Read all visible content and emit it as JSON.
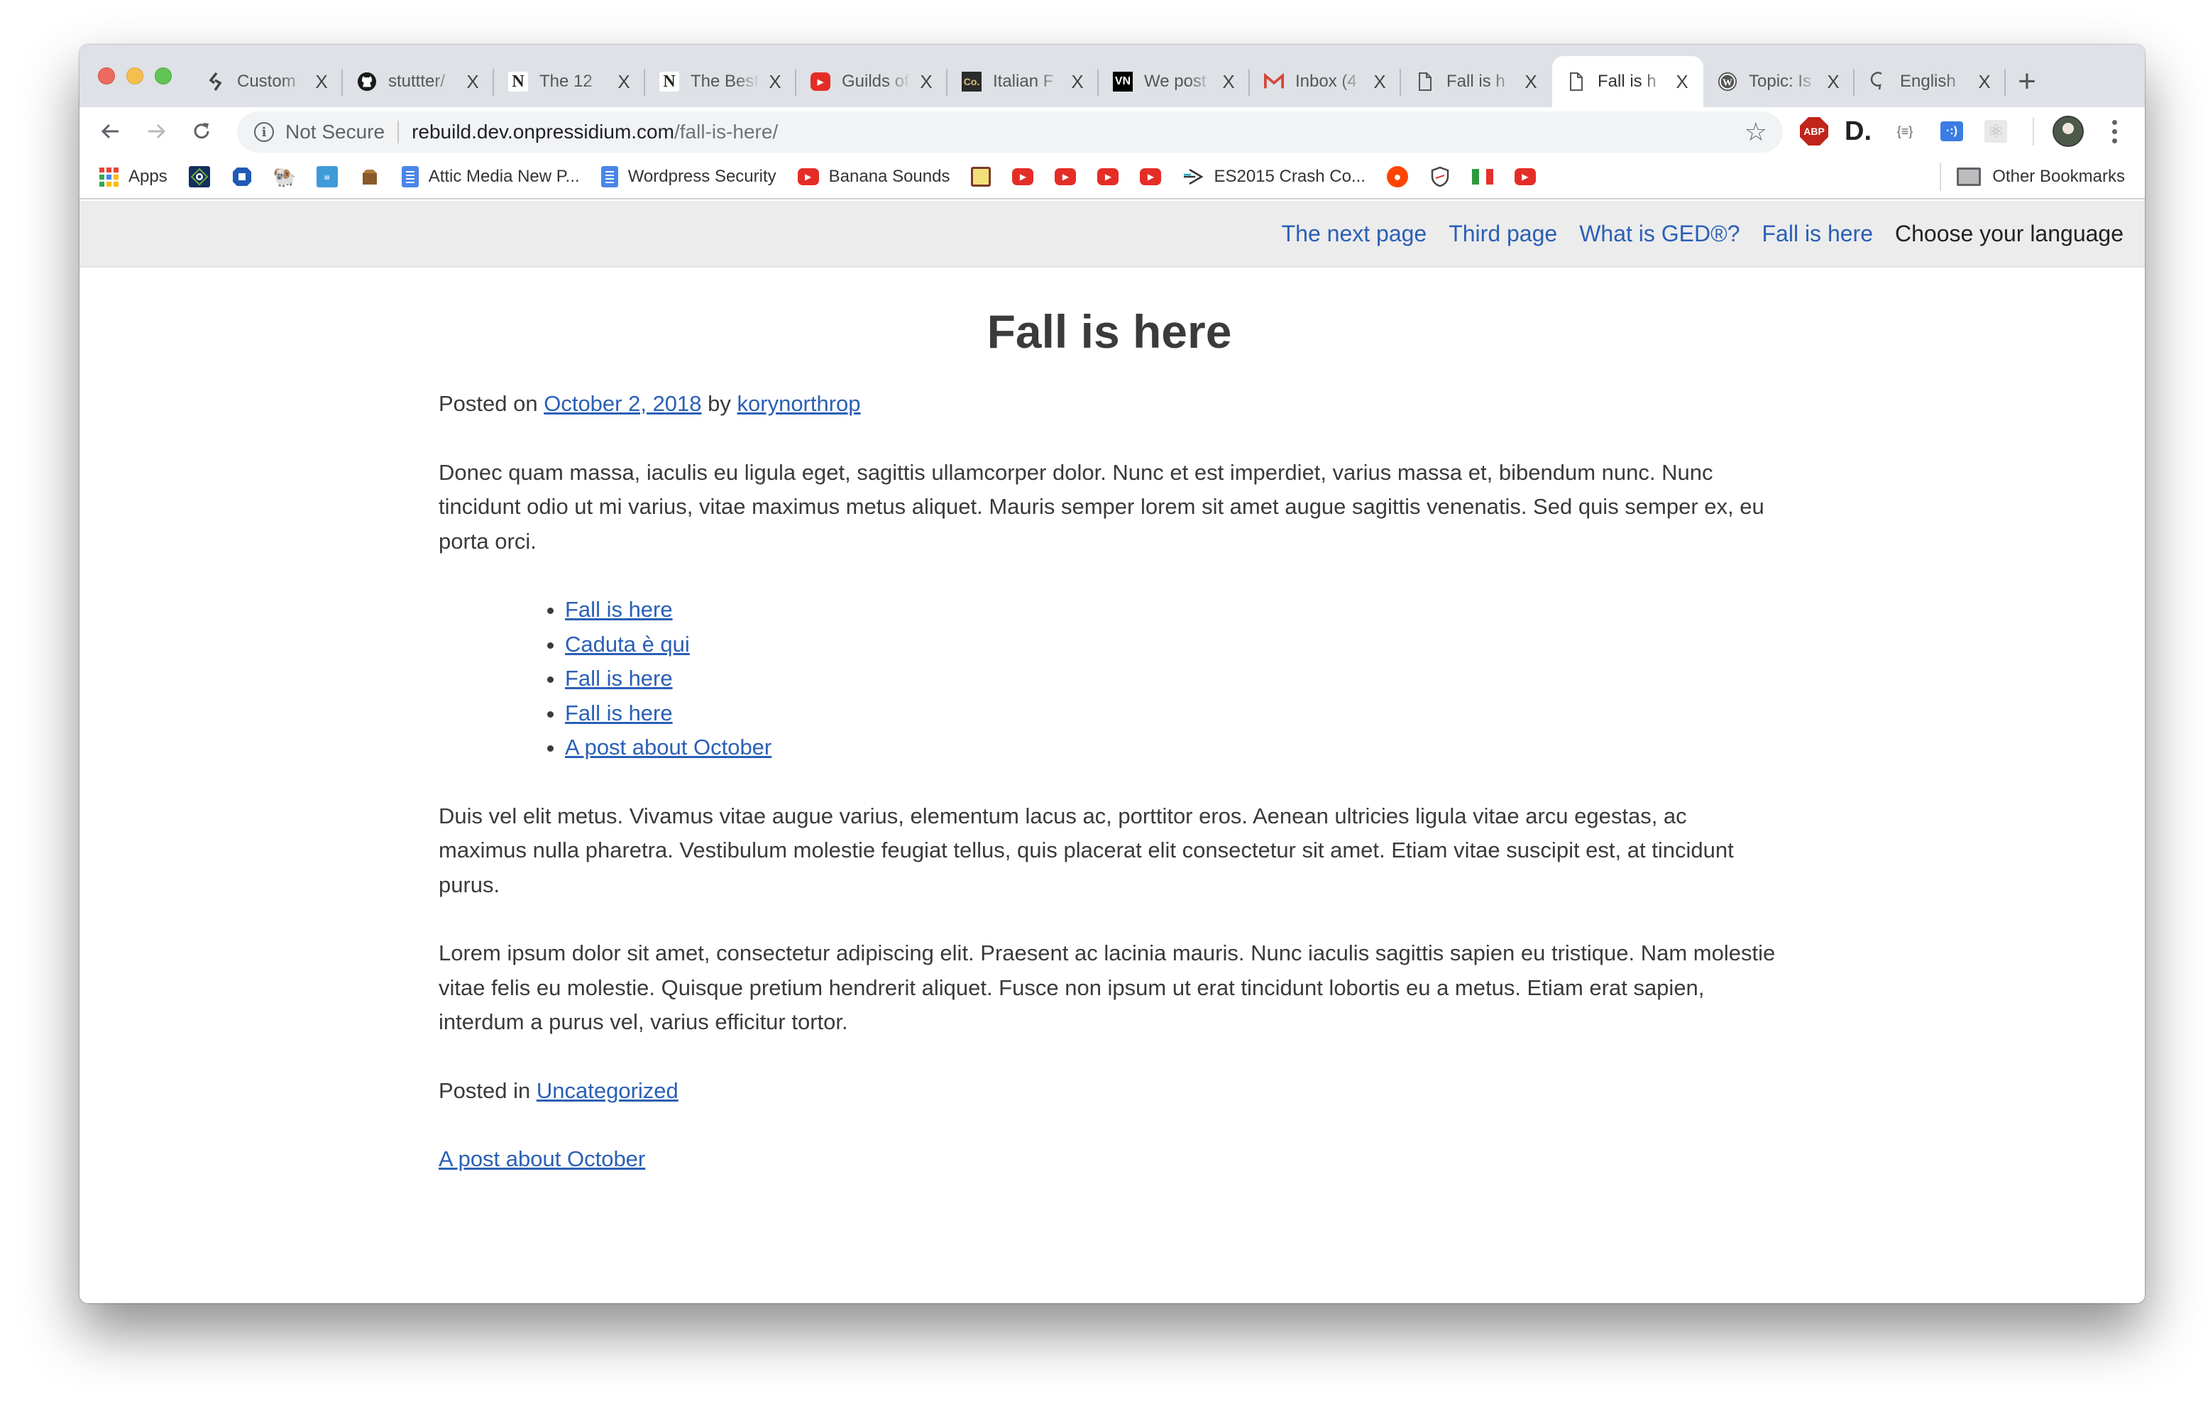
{
  "browser": {
    "tabs": [
      {
        "icon": "codeanywhere-icon",
        "title": "Custom",
        "active": false
      },
      {
        "icon": "github-icon",
        "title": "stuttter/",
        "active": false
      },
      {
        "icon": "notion-icon",
        "title": "The 12 ",
        "active": false
      },
      {
        "icon": "notion-icon",
        "title": "The Best",
        "active": false
      },
      {
        "icon": "youtube-icon",
        "title": "Guilds of",
        "active": false
      },
      {
        "icon": "co-icon",
        "title": "Italian F",
        "active": false
      },
      {
        "icon": "vn-icon",
        "title": "We post",
        "active": false
      },
      {
        "icon": "gmail-icon",
        "title": "Inbox (4",
        "active": false
      },
      {
        "icon": "page-icon",
        "title": "Fall is h",
        "active": false
      },
      {
        "icon": "page-icon",
        "title": "Fall is h",
        "active": true
      },
      {
        "icon": "wordpress-icon",
        "title": "Topic: Is",
        "active": false
      },
      {
        "icon": "english-icon",
        "title": "English",
        "active": false
      }
    ],
    "tab_close_glyph": "X",
    "new_tab_glyph": "+",
    "omnibox": {
      "security_label": "Not Secure",
      "url_host": "rebuild.dev.onpressidium.com",
      "url_path": "/fall-is-here/"
    },
    "extensions": {
      "abp_label": "ABP",
      "d_label": "D.",
      "json_label": "{≡}",
      "tag_label": "·:)"
    },
    "bookmarks": [
      {
        "icon": "apps-icon",
        "label": "Apps"
      },
      {
        "icon": "bank-diamond-icon",
        "label": ""
      },
      {
        "icon": "chase-icon",
        "label": ""
      },
      {
        "icon": "ram-icon",
        "label": ""
      },
      {
        "icon": "amex-icon",
        "label": ""
      },
      {
        "icon": "box-icon",
        "label": ""
      },
      {
        "icon": "google-docs-icon",
        "label": "Attic Media New P..."
      },
      {
        "icon": "google-docs-icon",
        "label": "Wordpress Security"
      },
      {
        "icon": "youtube-icon",
        "label": "Banana Sounds"
      },
      {
        "icon": "sticky-note-icon",
        "label": ""
      },
      {
        "icon": "youtube-icon",
        "label": ""
      },
      {
        "icon": "youtube-icon",
        "label": ""
      },
      {
        "icon": "youtube-icon",
        "label": ""
      },
      {
        "icon": "youtube-icon",
        "label": ""
      },
      {
        "icon": "send-arrow-icon",
        "label": "ES2015 Crash Co..."
      },
      {
        "icon": "reddit-icon",
        "label": ""
      },
      {
        "icon": "shield-ua-icon",
        "label": ""
      },
      {
        "icon": "italy-flag-icon",
        "label": ""
      },
      {
        "icon": "youtube-icon",
        "label": ""
      }
    ],
    "other_bookmarks_label": "Other Bookmarks"
  },
  "site": {
    "nav": [
      {
        "label": "The next page"
      },
      {
        "label": "Third page"
      },
      {
        "label": "What is GED®?"
      },
      {
        "label": "Fall is here"
      }
    ],
    "language_label": "Choose your language"
  },
  "post": {
    "title": "Fall is here",
    "meta_prefix": "Posted on ",
    "date": "October 2, 2018",
    "by": " by ",
    "author": "korynorthrop",
    "paragraphs": [
      "Donec quam massa, iaculis eu ligula eget, sagittis ullamcorper dolor. Nunc et est imperdiet, varius massa et, bibendum nunc. Nunc tincidunt odio ut mi varius, vitae maximus metus aliquet. Mauris semper lorem sit amet augue sagittis venenatis. Sed quis semper ex, eu porta orci.",
      "Duis vel elit metus. Vivamus vitae augue varius, elementum lacus ac, porttitor eros. Aenean ultricies ligula vitae arcu egestas, ac maximus nulla pharetra. Vestibulum molestie feugiat tellus, quis placerat elit consectetur sit amet. Etiam vitae suscipit est, at tincidunt purus.",
      "Lorem ipsum dolor sit amet, consectetur adipiscing elit. Praesent ac lacinia mauris. Nunc iaculis sagittis sapien eu tristique. Nam molestie vitae felis eu molestie. Quisque pretium hendrerit aliquet. Fusce non ipsum ut erat tincidunt lobortis eu a metus. Etiam erat sapien, interdum a purus vel, varius efficitur tortor."
    ],
    "related_links": [
      {
        "label": "Fall is here"
      },
      {
        "label": "Caduta è qui"
      },
      {
        "label": "Fall is here"
      },
      {
        "label": "Fall is here"
      },
      {
        "label": "A post about October"
      }
    ],
    "category_prefix": "Posted in ",
    "category": "Uncategorized",
    "next_post": "A post about October"
  },
  "colors": {
    "link": "#2a5fb6",
    "text": "#3a3a3a",
    "nav_bg": "#ececec",
    "tabstrip_bg": "#dee1e6"
  }
}
